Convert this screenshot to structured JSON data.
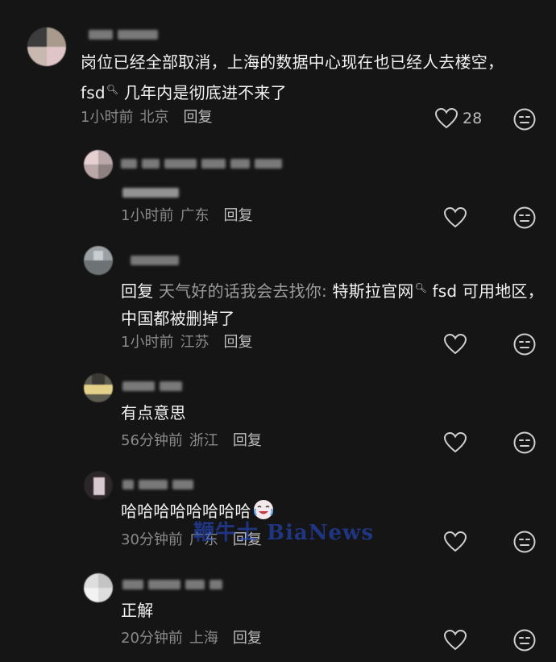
{
  "comments": [
    {
      "text_before": "岗位已经全部取消，上海的数据中心现在也已经人去楼空，",
      "search_term": "fsd",
      "text_after": "几年内是彻底进不来了",
      "time": "1小时前",
      "location": "北京",
      "reply_label": "回复",
      "like_count": "28"
    },
    {
      "text": "",
      "time": "1小时前",
      "location": "广东",
      "reply_label": "回复"
    },
    {
      "reply_prefix": "回复",
      "reply_to": "天气好的话我会去找你:",
      "text_before": "特斯拉官网",
      "text_after": "fsd 可用地区，中国都被删掉了",
      "time": "1小时前",
      "location": "江苏",
      "reply_label": "回复"
    },
    {
      "text": "有点意思",
      "time": "56分钟前",
      "location": "浙江",
      "reply_label": "回复"
    },
    {
      "text": "哈哈哈哈哈哈哈哈",
      "time": "30分钟前",
      "location": "广东",
      "reply_label": "回复"
    },
    {
      "text": "正解",
      "time": "20分钟前",
      "location": "上海",
      "reply_label": "回复"
    }
  ],
  "watermark": "鞭牛士 BiaNews",
  "icons": {
    "like": "heart-outline-icon",
    "dislike": "meh-face-icon",
    "search": "search-magnifier-icon",
    "emoji": "crying-laughing-emoji-icon"
  },
  "colors": {
    "background": "#151515",
    "text": "#f2f2f2",
    "meta": "#8a8a8a",
    "watermark": "#2850dc"
  }
}
